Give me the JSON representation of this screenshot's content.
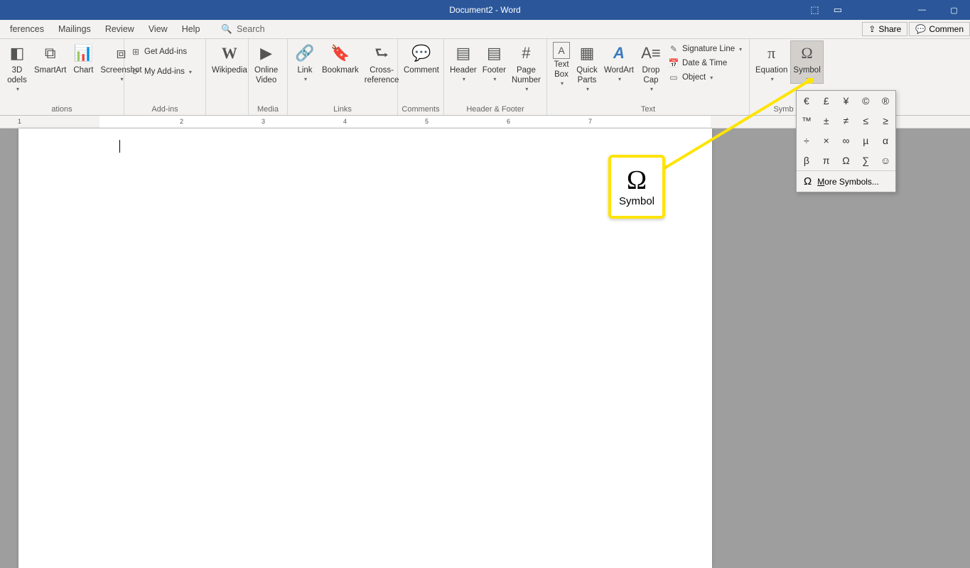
{
  "title": "Document2 - Word",
  "tabs": [
    "ferences",
    "Mailings",
    "Review",
    "View",
    "Help"
  ],
  "search_placeholder": "Search",
  "share": {
    "share": "Share",
    "comment": "Commen"
  },
  "groups": {
    "illustrations": {
      "label": "ations",
      "btns": {
        "models": "3D\nodels",
        "smartart": "SmartArt",
        "chart": "Chart",
        "screenshot": "Screenshot"
      }
    },
    "addins": {
      "label": "Add-ins",
      "get": "Get Add-ins",
      "my": "My Add-ins"
    },
    "wiki": {
      "label": "Wikipedia"
    },
    "media": {
      "label": "Media",
      "btn": "Online\nVideo"
    },
    "links": {
      "label": "Links",
      "link": "Link",
      "bookmark": "Bookmark",
      "crossref": "Cross-\nreference"
    },
    "comments": {
      "label": "Comments",
      "btn": "Comment"
    },
    "hf": {
      "label": "Header & Footer",
      "header": "Header",
      "footer": "Footer",
      "pagenum": "Page\nNumber"
    },
    "text": {
      "label": "Text",
      "textbox": "Text\nBox",
      "quick": "Quick\nParts",
      "wordart": "WordArt",
      "dropcap": "Drop\nCap",
      "sig": "Signature Line",
      "dt": "Date & Time",
      "obj": "Object"
    },
    "symbols": {
      "label": "Symb",
      "equation": "Equation",
      "symbol": "Symbol"
    }
  },
  "ruler_marks": [
    "1",
    "2",
    "3",
    "4",
    "5",
    "6",
    "7"
  ],
  "symbol_dd": {
    "cells": [
      "€",
      "£",
      "¥",
      "©",
      "®",
      "™",
      "±",
      "≠",
      "≤",
      "≥",
      "÷",
      "×",
      "∞",
      "µ",
      "α",
      "β",
      "π",
      "Ω",
      "∑",
      "☺"
    ],
    "more": "More Symbols..."
  },
  "callout": {
    "label": "Symbol",
    "glyph": "Ω"
  }
}
